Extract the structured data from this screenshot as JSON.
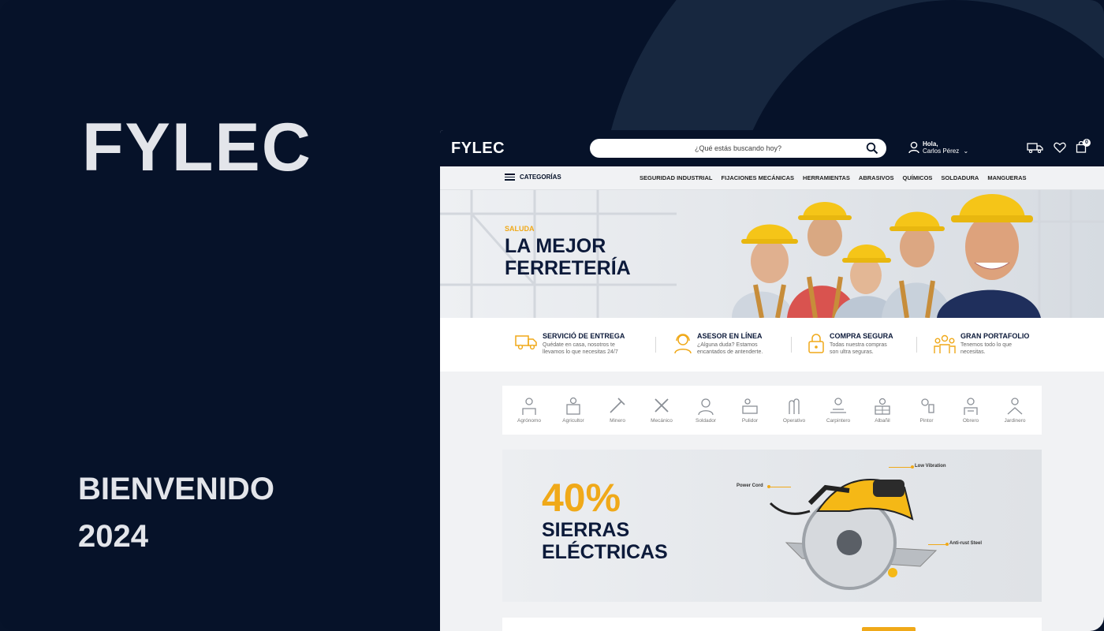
{
  "brand": {
    "title": "FYLEC"
  },
  "welcome": {
    "line1": "BIENVENIDO",
    "line2": "2024"
  },
  "site": {
    "logo": "FYLEC",
    "search": {
      "placeholder": "¿Qué estás buscando hoy?"
    },
    "user": {
      "greeting": "Hola,",
      "name": "Carlos Pérez"
    },
    "cart_count": "0",
    "categories_label": "CATEGORÍAS",
    "nav": [
      "SEGURIDAD INDUSTRIAL",
      "FIJACIONES MECÁNICAS",
      "HERRAMIENTAS",
      "ABRASIVOS",
      "QUÍMICOS",
      "SOLDADURA",
      "MANGUERAS"
    ],
    "hero": {
      "kicker": "SALUDA",
      "title": "LA MEJOR FERRETERÍA"
    },
    "features": [
      {
        "title": "SERVICIÓ DE ENTREGA",
        "desc1": "Quédate en casa, nosotros te",
        "desc2": "llevamos lo que necesitas 24/7",
        "icon": "truck-icon"
      },
      {
        "title": "ASESOR EN LÍNEA",
        "desc1": "¿Alguna duda? Estamos",
        "desc2": "encantados de antenderte.",
        "icon": "headset-icon"
      },
      {
        "title": "COMPRA SEGURA",
        "desc1": "Todas nuestra compras",
        "desc2": "son ultra seguras.",
        "icon": "lock-icon"
      },
      {
        "title": "GRAN PORTAFOLIO",
        "desc1": "Tenemos todo lo que",
        "desc2": "necesitas.",
        "icon": "people-icon"
      }
    ],
    "trades": [
      "Agrónomo",
      "Agricultor",
      "Minero",
      "Mecánico",
      "Soldador",
      "Pulidor",
      "Operativo",
      "Carpintero",
      "Albañil",
      "Pintor",
      "Obrero",
      "Jardinero"
    ],
    "promo": {
      "percent": "40%",
      "line1": "SIERRAS",
      "line2": "ELÉCTRICAS",
      "callouts": {
        "low_vibration": "Low Vibration",
        "power_cord": "Power Cord",
        "anti_rust": "Anti-rust Steel"
      }
    }
  },
  "colors": {
    "navy": "#061229",
    "accent": "#f0a919",
    "arc": "#17273f"
  }
}
